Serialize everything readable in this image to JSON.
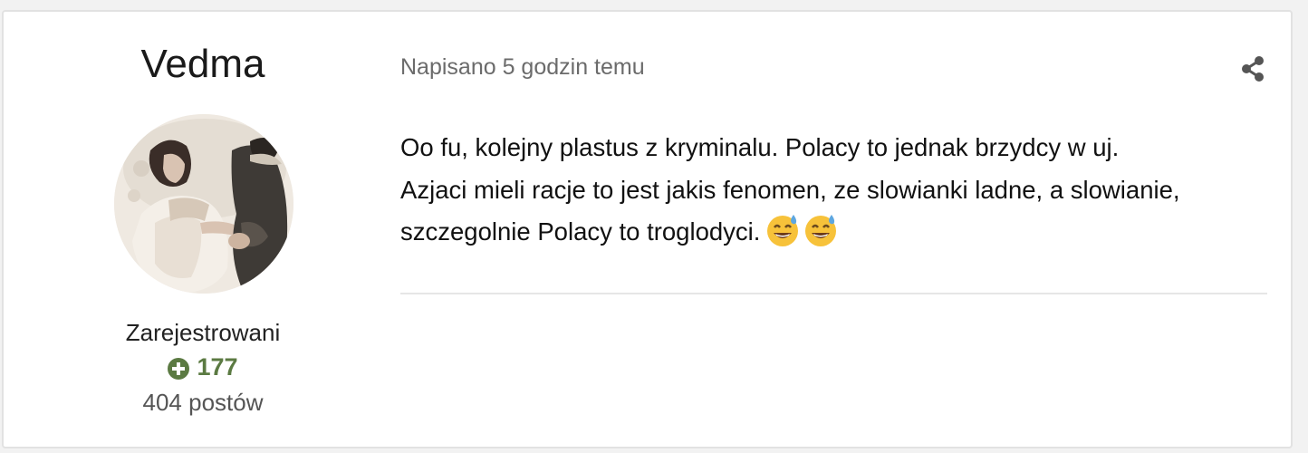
{
  "author": {
    "name": "Vedma",
    "group": "Zarejestrowani",
    "reputation": "177",
    "post_count": "404 postów",
    "avatar_icon": "avatar-image"
  },
  "post": {
    "meta": "Napisano 5 godzin temu",
    "body_lines": [
      "Oo fu, kolejny plastus z kryminalu. Polacy to jednak brzydcy w uj.",
      "Azjaci mieli racje to jest jakis fenomen, ze slowianki ladne, a slowianie,",
      "szczegolnie Polacy to troglodyci."
    ],
    "emoji": [
      "grinning-face-with-sweat",
      "grinning-face-with-sweat"
    ]
  },
  "icons": {
    "share": "share-icon",
    "reputation": "plus-circle-icon"
  },
  "colors": {
    "reputation": "#5b7a42",
    "meta_text": "#6b6b6b",
    "card_border": "#e2e2e2"
  }
}
